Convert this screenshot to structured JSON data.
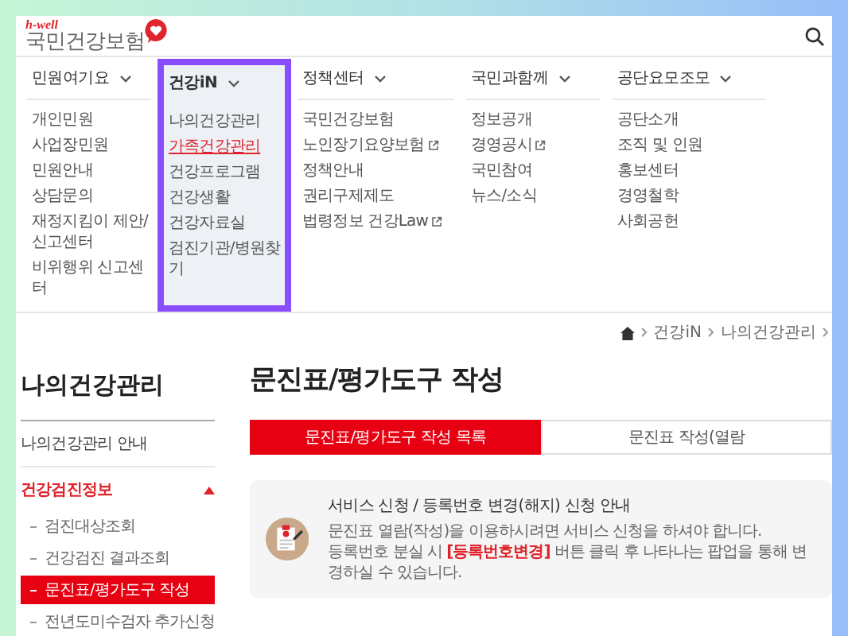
{
  "logo": {
    "tagline": "h-well",
    "name": "국민건강보험"
  },
  "nav": [
    {
      "label": "민원여기요",
      "selected": false,
      "items": [
        {
          "label": "개인민원",
          "selected": false,
          "external": false
        },
        {
          "label": "사업장민원",
          "selected": false,
          "external": false
        },
        {
          "label": "민원안내",
          "selected": false,
          "external": false
        },
        {
          "label": "상담문의",
          "selected": false,
          "external": false
        },
        {
          "label": "재정지킴이 제안/신고센터",
          "selected": false,
          "external": false
        },
        {
          "label": "비위행위 신고센터",
          "selected": false,
          "external": false
        }
      ]
    },
    {
      "label": "건강iN",
      "selected": true,
      "items": [
        {
          "label": "나의건강관리",
          "selected": false,
          "external": false
        },
        {
          "label": "가족건강관리",
          "selected": true,
          "external": false
        },
        {
          "label": "건강프로그램",
          "selected": false,
          "external": false
        },
        {
          "label": "건강생활",
          "selected": false,
          "external": false
        },
        {
          "label": "건강자료실",
          "selected": false,
          "external": false
        },
        {
          "label": "검진기관/병원찾기",
          "selected": false,
          "external": false
        }
      ]
    },
    {
      "label": "정책센터",
      "selected": false,
      "items": [
        {
          "label": "국민건강보험",
          "selected": false,
          "external": false
        },
        {
          "label": "노인장기요양보험",
          "selected": false,
          "external": true
        },
        {
          "label": "정책안내",
          "selected": false,
          "external": false
        },
        {
          "label": "권리구제제도",
          "selected": false,
          "external": false
        },
        {
          "label": "법령정보 건강Law",
          "selected": false,
          "external": true
        }
      ]
    },
    {
      "label": "국민과함께",
      "selected": false,
      "items": [
        {
          "label": "정보공개",
          "selected": false,
          "external": false
        },
        {
          "label": "경영공시",
          "selected": false,
          "external": true
        },
        {
          "label": "국민참여",
          "selected": false,
          "external": false
        },
        {
          "label": "뉴스/소식",
          "selected": false,
          "external": false
        }
      ]
    },
    {
      "label": "공단요모조모",
      "selected": false,
      "items": [
        {
          "label": "공단소개",
          "selected": false,
          "external": false
        },
        {
          "label": "조직 및 인원",
          "selected": false,
          "external": false
        },
        {
          "label": "홍보센터",
          "selected": false,
          "external": false
        },
        {
          "label": "경영철학",
          "selected": false,
          "external": false
        },
        {
          "label": "사회공헌",
          "selected": false,
          "external": false
        }
      ]
    }
  ],
  "breadcrumb": [
    "건강iN",
    "나의건강관리"
  ],
  "sidebar": {
    "title": "나의건강관리",
    "items": [
      {
        "label": "나의건강관리 안내"
      },
      {
        "label": "건강검진정보",
        "expanded": true,
        "children": [
          {
            "label": "검진대상조회",
            "selected": false
          },
          {
            "label": "건강검진 결과조회",
            "selected": false
          },
          {
            "label": "문진표/평가도구 작성",
            "selected": true
          },
          {
            "label": "전년도미수검자 추가신청",
            "selected": false
          }
        ]
      }
    ]
  },
  "main": {
    "title": "문진표/평가도구 작성",
    "tabs": [
      {
        "label": "문진표/평가도구 작성 목록",
        "selected": true
      },
      {
        "label": "문진표 작성(열람",
        "selected": false
      }
    ],
    "notice": {
      "title": "서비스 신청 / 등록번호 변경(해지) 신청 안내",
      "lines": [
        "문진표 열람(작성)을 이용하시려면 서비스 신청을 하셔야 합니다.",
        "등록번호 분실 시 **[등록번호변경]** 버튼 클릭 후 나타나는 팝업을 통해 변경하실 수 있습니다."
      ]
    }
  }
}
